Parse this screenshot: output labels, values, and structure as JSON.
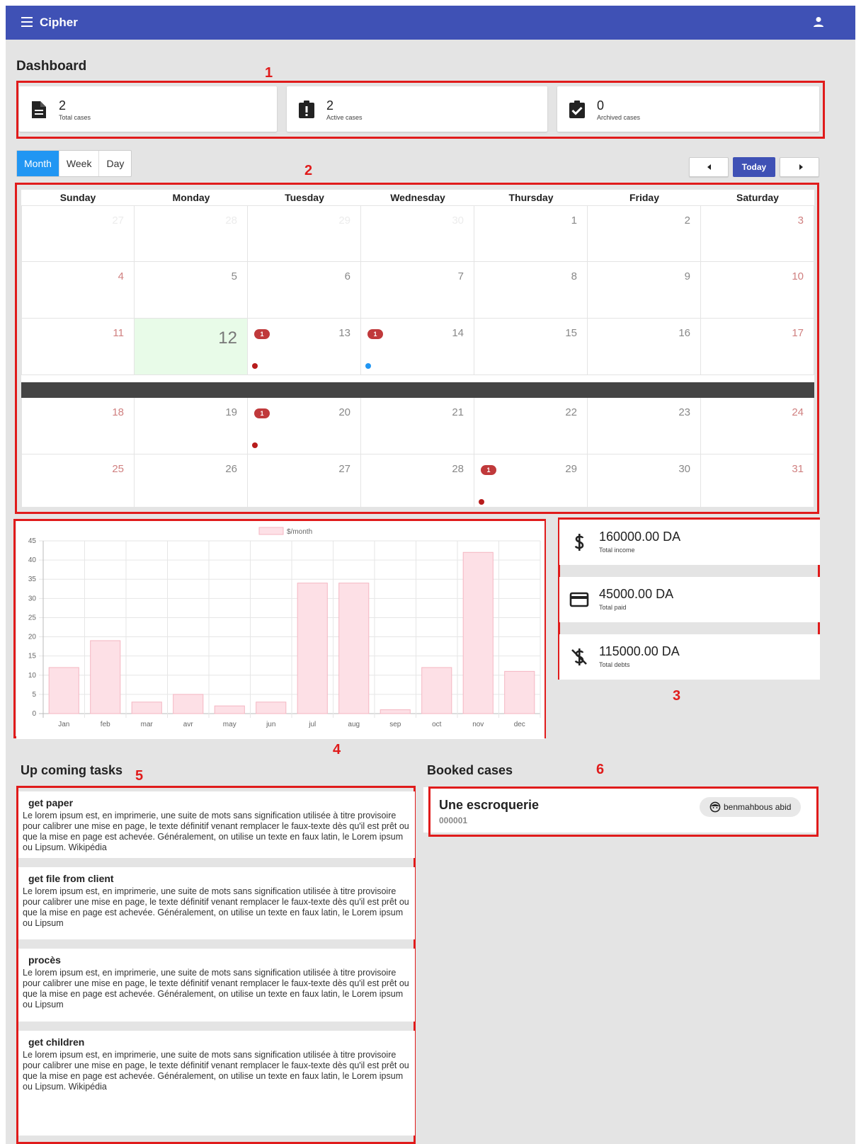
{
  "app": {
    "title": "Cipher"
  },
  "page": {
    "title": "Dashboard"
  },
  "stats": [
    {
      "value": "2",
      "label": "Total cases",
      "icon": "file-document-icon"
    },
    {
      "value": "2",
      "label": "Active cases",
      "icon": "clipboard-alert-icon"
    },
    {
      "value": "0",
      "label": "Archived cases",
      "icon": "clipboard-check-icon"
    }
  ],
  "views": [
    "Month",
    "Week",
    "Day"
  ],
  "active_view": "Month",
  "nav": {
    "today": "Today"
  },
  "calendar": {
    "weekdays": [
      "Sunday",
      "Monday",
      "Tuesday",
      "Wednesday",
      "Thursday",
      "Friday",
      "Saturday"
    ],
    "weeks": [
      [
        "27",
        "28",
        "29",
        "30",
        "1",
        "2",
        "3"
      ],
      [
        "4",
        "5",
        "6",
        "7",
        "8",
        "9",
        "10"
      ],
      [
        "11",
        "12",
        "13",
        "14",
        "15",
        "16",
        "17"
      ],
      [
        "18",
        "19",
        "20",
        "21",
        "22",
        "23",
        "24"
      ],
      [
        "25",
        "26",
        "27",
        "28",
        "29",
        "30",
        "31"
      ]
    ],
    "today": "12",
    "events": [
      {
        "week": 2,
        "day": 2,
        "count": "1",
        "dot_color": "#b71c1c"
      },
      {
        "week": 2,
        "day": 3,
        "count": "1",
        "dot_color": "#2196f3"
      },
      {
        "week": 3,
        "day": 2,
        "count": "1",
        "dot_color": "#b71c1c"
      },
      {
        "week": 4,
        "day": 4,
        "count": "1",
        "dot_color": "#b71c1c"
      }
    ]
  },
  "chart_data": {
    "type": "bar",
    "categories": [
      "Jan",
      "feb",
      "mar",
      "avr",
      "may",
      "jun",
      "jul",
      "aug",
      "sep",
      "oct",
      "nov",
      "dec"
    ],
    "series": [
      {
        "name": "$/month",
        "values": [
          12,
          19,
          3,
          5,
          2,
          3,
          34,
          34,
          1,
          12,
          42,
          11
        ]
      }
    ],
    "ylim": [
      0,
      45
    ],
    "yticks": [
      0,
      5,
      10,
      15,
      20,
      25,
      30,
      35,
      40,
      45
    ],
    "legend": "top",
    "grid": true,
    "bar_color": "#fde0e6",
    "bar_border": "#f4b6c2"
  },
  "finance": [
    {
      "amount": "160000.00 DA",
      "label": "Total income",
      "icon": "dollar-icon"
    },
    {
      "amount": "45000.00 DA",
      "label": "Total paid",
      "icon": "credit-card-icon"
    },
    {
      "amount": "115000.00 DA",
      "label": "Total debts",
      "icon": "dollar-off-icon"
    }
  ],
  "tasks_title": "Up coming tasks",
  "tasks": [
    {
      "title": "get paper",
      "body": "Le lorem ipsum est, en imprimerie, une suite de mots sans signification utilisée à titre provisoire pour calibrer une mise en page, le texte définitif venant remplacer le faux-texte dès qu'il est prêt ou que la mise en page est achevée. Généralement, on utilise un texte en faux latin, le Lorem ipsum ou Lipsum. Wikipédia"
    },
    {
      "title": "get file from client",
      "body": "Le lorem ipsum est, en imprimerie, une suite de mots sans signification utilisée à titre provisoire pour calibrer une mise en page, le texte définitif venant remplacer le faux-texte dès qu'il est prêt ou que la mise en page est achevée. Généralement, on utilise un texte en faux latin, le Lorem ipsum ou Lipsum"
    },
    {
      "title": "procès",
      "body": "Le lorem ipsum est, en imprimerie, une suite de mots sans signification utilisée à titre provisoire pour calibrer une mise en page, le texte définitif venant remplacer le faux-texte dès qu'il est prêt ou que la mise en page est achevée. Généralement, on utilise un texte en faux latin, le Lorem ipsum ou Lipsum"
    },
    {
      "title": "get children",
      "body": "Le lorem ipsum est, en imprimerie, une suite de mots sans signification utilisée à titre provisoire pour calibrer une mise en page, le texte définitif venant remplacer le faux-texte dès qu'il est prêt ou que la mise en page est achevée. Généralement, on utilise un texte en faux latin, le Lorem ipsum ou Lipsum. Wikipédia"
    }
  ],
  "booked_title": "Booked cases",
  "booked": {
    "title": "Une escroquerie",
    "number": "000001",
    "owner": "benmahbous abid",
    "owner_icon": "face-icon"
  },
  "annotations": [
    "1",
    "2",
    "3",
    "4",
    "5",
    "6"
  ],
  "colors": {
    "primary": "#3f51b5",
    "accent": "#2196f3",
    "annotation": "#e01b1b",
    "event": "#c0393b"
  }
}
